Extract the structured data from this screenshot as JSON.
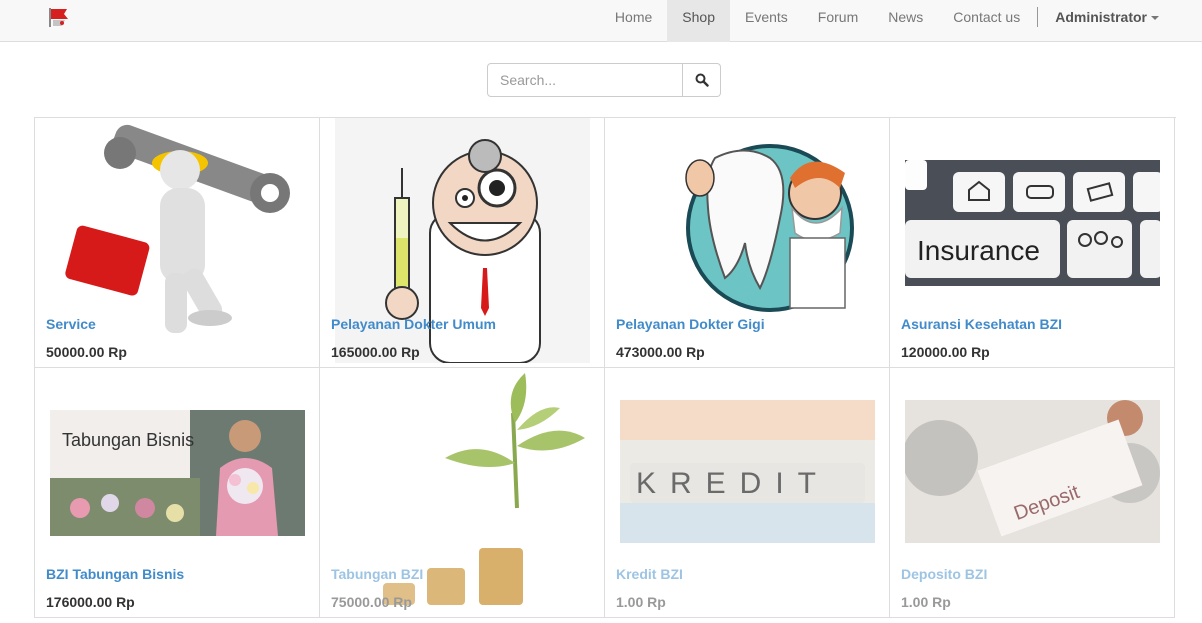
{
  "nav": {
    "items": [
      "Home",
      "Shop",
      "Events",
      "Forum",
      "News",
      "Contact us"
    ],
    "active": "Shop",
    "user": "Administrator"
  },
  "search": {
    "placeholder": "Search..."
  },
  "products": [
    {
      "name": "Service",
      "price": "50000.00 Rp",
      "image": "worker-wrench-toolbox"
    },
    {
      "name": "Pelayanan Dokter Umum",
      "price": "165000.00 Rp",
      "image": "cartoon-doctor-syringe"
    },
    {
      "name": "Pelayanan Dokter Gigi",
      "price": "473000.00 Rp",
      "image": "dentist-tooth"
    },
    {
      "name": "Asuransi Kesehatan BZI",
      "price": "120000.00 Rp",
      "image": "insurance-keyboard",
      "image_text": "Insurance"
    },
    {
      "name": "BZI Tabungan Bisnis",
      "price": "176000.00 Rp",
      "image": "woman-flowers-shop",
      "image_text": "Tabungan Bisnis"
    },
    {
      "name": "Tabungan BZI",
      "price": "75000.00 Rp",
      "image": "plant-coins"
    },
    {
      "name": "Kredit BZI",
      "price": "1.00 Rp",
      "image": "kredit-blocks",
      "image_text": "KREDIT"
    },
    {
      "name": "Deposito BZI",
      "price": "1.00 Rp",
      "image": "deposit-slip-coins",
      "image_text": "Deposit"
    }
  ],
  "colors": {
    "link": "#428bca",
    "navbar_bg": "#f8f8f8",
    "active_bg": "#e7e7e7"
  }
}
